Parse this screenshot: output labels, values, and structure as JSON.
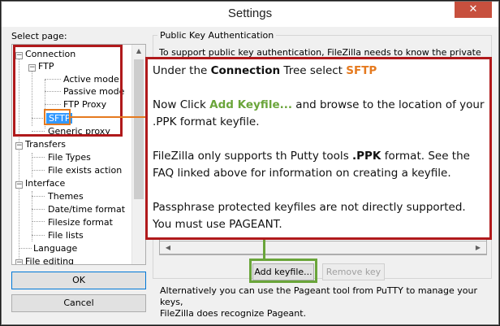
{
  "window": {
    "title": "Settings",
    "close_glyph": "✕"
  },
  "sidebar": {
    "label": "Select page:",
    "items": [
      {
        "label": "Connection",
        "expander": "−"
      },
      {
        "label": "FTP",
        "expander": "−"
      },
      {
        "label": "Active mode"
      },
      {
        "label": "Passive mode"
      },
      {
        "label": "FTP Proxy"
      },
      {
        "label": "SFTP"
      },
      {
        "label": "Generic proxy"
      },
      {
        "label": "Transfers",
        "expander": "−"
      },
      {
        "label": "File Types"
      },
      {
        "label": "File exists action"
      },
      {
        "label": "Interface",
        "expander": "−"
      },
      {
        "label": "Themes"
      },
      {
        "label": "Date/time format"
      },
      {
        "label": "Filesize format"
      },
      {
        "label": "File lists"
      },
      {
        "label": "Language"
      },
      {
        "label": "File editing",
        "expander": "−"
      }
    ],
    "selected": "SFTP",
    "ok_label": "OK",
    "cancel_label": "Cancel"
  },
  "main": {
    "group_title": "Public Key Authentication",
    "intro": "To support public key authentication, FileZilla needs to know the private keys to",
    "add_keyfile_label": "Add keyfile...",
    "remove_key_label": "Remove key",
    "footer_line1": "Alternatively you can use the Pageant tool from PuTTY to manage your keys,",
    "footer_line2": "FileZilla does recognize Pageant."
  },
  "callout": {
    "p1_pre": "Under the ",
    "p1_bold": "Connection",
    "p1_mid": " Tree select ",
    "p1_orange": "SFTP",
    "p2_pre": "Now Click ",
    "p2_green": "Add Keyfile...",
    "p2_post": " and browse to the location of your .PPK format keyfile.",
    "p3_pre": "FileZilla only supports th Putty tools ",
    "p3_bold": ".PPK",
    "p3_post": " format. See the FAQ linked above for information on creating a keyfile.",
    "p4": "Passphrase protected keyfiles are not directly supported. You must use PAGEANT."
  },
  "colors": {
    "highlight_red": "#b0191b",
    "highlight_orange": "#e57a1f",
    "highlight_green": "#6aa53a",
    "selection_blue": "#3399ff"
  }
}
